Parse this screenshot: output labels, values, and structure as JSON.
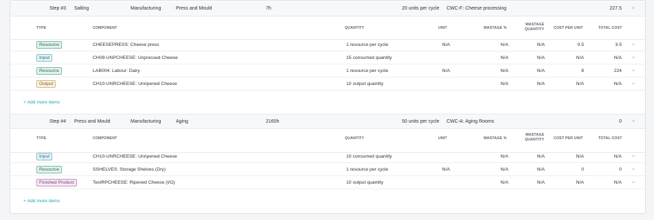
{
  "steps": [
    {
      "step": "Step #3",
      "from": "Salting",
      "type": "Manufacturing",
      "to": "Press and Mould",
      "duration": "7h",
      "rate": "20 units per cycle",
      "work_center": "CWC-F: Cheese processing",
      "total": "227.5",
      "headers": {
        "type": "TYPE",
        "component": "COMPONENT",
        "quantity": "QUANTITY",
        "unit": "UNIT",
        "wastage_pct": "WASTAGE %",
        "wastage_qty_1": "WASTAGE",
        "wastage_qty_2": "QUANTITY",
        "cost_per_unit": "COST PER UNIT",
        "total_cost": "TOTAL COST"
      },
      "rows": [
        {
          "type": "Resource",
          "component": "CHEESEPRESS: Cheese press",
          "quantity": "1 resource per cycle",
          "unit": "N/A",
          "wastage_pct": "N/A",
          "wastage_qty": "N/A",
          "cost_per_unit": "0.5",
          "total_cost": "3.5"
        },
        {
          "type": "Input",
          "component": "CH09-UNPCHEESE: Unpressed Cheese",
          "quantity": "15 consumed quantity",
          "unit": "",
          "wastage_pct": "N/A",
          "wastage_qty": "N/A",
          "cost_per_unit": "N/A",
          "total_cost": "N/A"
        },
        {
          "type": "Resource",
          "component": "LAB004: Labour: Dairy",
          "quantity": "1 resource per cycle",
          "unit": "N/A",
          "wastage_pct": "N/A",
          "wastage_qty": "N/A",
          "cost_per_unit": "8",
          "total_cost": "224"
        },
        {
          "type": "Output",
          "component": "CH10-UNRCHEESE: Unripened Cheese",
          "quantity": "10 output quantity",
          "unit": "",
          "wastage_pct": "N/A",
          "wastage_qty": "N/A",
          "cost_per_unit": "N/A",
          "total_cost": "N/A"
        }
      ],
      "add_more": "+ Add more items"
    },
    {
      "step": "Step #4",
      "from": "Press and Mould",
      "type": "Manufacturing",
      "to": "Aging",
      "duration": "2160h",
      "rate": "50 units per cycle",
      "work_center": "CWC-A: Aging Rooms",
      "total": "0",
      "headers": {
        "type": "TYPE",
        "component": "COMPONENT",
        "quantity": "QUANTITY",
        "unit": "UNIT",
        "wastage_pct": "WASTAGE %",
        "wastage_qty_1": "WASTAGE",
        "wastage_qty_2": "QUANTITY",
        "cost_per_unit": "COST PER UNIT",
        "total_cost": "TOTAL COST"
      },
      "rows": [
        {
          "type": "Input",
          "component": "CH10-UNRCHEESE: Unripened Cheese",
          "quantity": "10 consumed quantity",
          "unit": "",
          "wastage_pct": "N/A",
          "wastage_qty": "N/A",
          "cost_per_unit": "N/A",
          "total_cost": "N/A"
        },
        {
          "type": "Resource",
          "component": "SSHELVES: Storage Shelves (Dry)",
          "quantity": "1 resource per cycle",
          "unit": "N/A",
          "wastage_pct": "N/A",
          "wastage_qty": "N/A",
          "cost_per_unit": "0",
          "total_cost": "0"
        },
        {
          "type": "Finished Product",
          "component": "TestRPCHEESE: Ripened Cheese (I/O)",
          "quantity": "10 output quantity",
          "unit": "",
          "wastage_pct": "N/A",
          "wastage_qty": "N/A",
          "cost_per_unit": "N/A",
          "total_cost": "N/A"
        }
      ],
      "add_more": "+ Add more items"
    }
  ],
  "close_glyph": "×",
  "badge_colors": {
    "Resource": "#77b9a3",
    "Input": "#7dbcd0",
    "Output": "#d2b478",
    "Finished Product": "#c98ebf"
  },
  "accent_color": "#16a6b6"
}
